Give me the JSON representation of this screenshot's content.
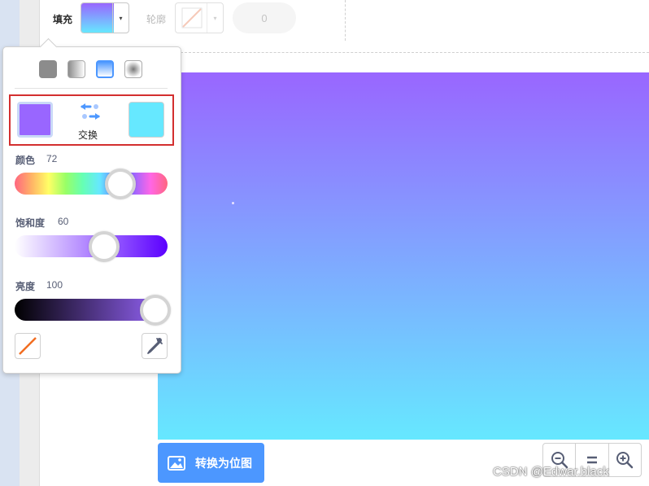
{
  "toolbar": {
    "fill_label": "填充",
    "outline_label": "轮廓",
    "stroke_width": "0",
    "dropdown_glyph": "▾"
  },
  "colors": {
    "gradient_top": "#9966ff",
    "gradient_bottom": "#66e8ff",
    "accent": "#4c97ff",
    "highlight": "#d32f2f"
  },
  "color_picker": {
    "fill_modes": [
      "solid",
      "horizontal-gradient",
      "vertical-gradient",
      "radial-gradient"
    ],
    "selected_mode": "vertical-gradient",
    "swap_label": "交换",
    "color_a": "#9966ff",
    "color_b": "#66e8ff",
    "hue": {
      "label": "颜色",
      "value": "72"
    },
    "saturation": {
      "label": "饱和度",
      "value": "60"
    },
    "brightness": {
      "label": "亮度",
      "value": "100"
    }
  },
  "canvas": {
    "convert_button_label": "转换为位图"
  },
  "zoom": {
    "buttons": [
      "zoom-out",
      "reset",
      "zoom-in"
    ]
  },
  "watermark": "CSDN @Edwar.black"
}
